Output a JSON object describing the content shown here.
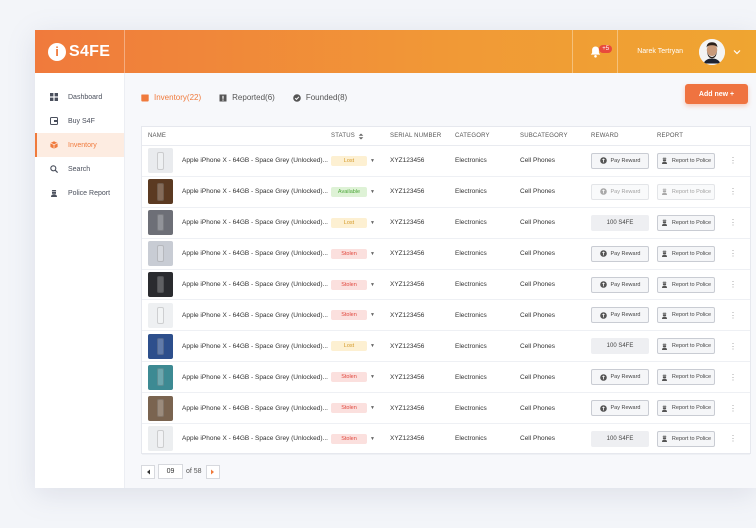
{
  "brand": {
    "logo_letter": "i",
    "name": "S4FE"
  },
  "header": {
    "notification_badge": "+5",
    "user_name": "Narek Tertryan",
    "icons": {
      "bell": "bell-icon",
      "chevron": "chevron-down-icon"
    }
  },
  "sidebar": {
    "items": [
      {
        "label": "Dashboard",
        "icon": "dashboard-icon",
        "active": false
      },
      {
        "label": "Buy S4F",
        "icon": "wallet-icon",
        "active": false
      },
      {
        "label": "Inventory",
        "icon": "box-icon",
        "active": true
      },
      {
        "label": "Search",
        "icon": "search-icon",
        "active": false
      },
      {
        "label": "Police Report",
        "icon": "police-icon",
        "active": false
      }
    ]
  },
  "tabs": [
    {
      "label": "Inventory(22)",
      "icon": "box-icon",
      "active": true
    },
    {
      "label": "Reported(6)",
      "icon": "report-icon",
      "active": false
    },
    {
      "label": "Founded(8)",
      "icon": "check-circle-icon",
      "active": false
    }
  ],
  "add_new": "Add new  +",
  "table": {
    "columns": [
      "NAME",
      "STATUS",
      "SERIAL NUMBER",
      "CATEGORY",
      "SUBCATEGORY",
      "REWARD",
      "REPORT"
    ],
    "status_sort_icon": "sort-icon",
    "rows": [
      {
        "name": "Apple iPhone X - 64GB - Space Grey (Unlocked)...",
        "status": "Lost",
        "status_type": "lost",
        "serial": "XYZ123456",
        "category": "Electronics",
        "subcategory": "Cell Phones",
        "reward": "Pay Reward",
        "reward_type": "button",
        "reward_disabled": false,
        "report": "Report to Police",
        "report_disabled": false,
        "thumb_color": "#e9ebee"
      },
      {
        "name": "Apple iPhone X - 64GB - Space Grey (Unlocked)...",
        "status": "Available",
        "status_type": "available",
        "serial": "XYZ123456",
        "category": "Electronics",
        "subcategory": "Cell Phones",
        "reward": "Pay Reward",
        "reward_type": "button",
        "reward_disabled": true,
        "report": "Report to Police",
        "report_disabled": true,
        "thumb_color": "#5b3a22"
      },
      {
        "name": "Apple iPhone X - 64GB - Space Grey (Unlocked)...",
        "status": "Lost",
        "status_type": "lost",
        "serial": "XYZ123456",
        "category": "Electronics",
        "subcategory": "Cell Phones",
        "reward": "100 S4FE",
        "reward_type": "amount",
        "reward_disabled": false,
        "report": "Report to Police",
        "report_disabled": false,
        "thumb_color": "#6d6f77"
      },
      {
        "name": "Apple iPhone X - 64GB - Space Grey (Unlocked)...",
        "status": "Stolen",
        "status_type": "stolen",
        "serial": "XYZ123456",
        "category": "Electronics",
        "subcategory": "Cell Phones",
        "reward": "Pay Reward",
        "reward_type": "button",
        "reward_disabled": false,
        "report": "Report to Police",
        "report_disabled": false,
        "thumb_color": "#c8ccd4"
      },
      {
        "name": "Apple iPhone X - 64GB - Space Grey (Unlocked)...",
        "status": "Stolen",
        "status_type": "stolen",
        "serial": "XYZ123456",
        "category": "Electronics",
        "subcategory": "Cell Phones",
        "reward": "Pay Reward",
        "reward_type": "button",
        "reward_disabled": false,
        "report": "Report to Police",
        "report_disabled": false,
        "thumb_color": "#2a2b2f"
      },
      {
        "name": "Apple iPhone X - 64GB - Space Grey (Unlocked)...",
        "status": "Stolen",
        "status_type": "stolen",
        "serial": "XYZ123456",
        "category": "Electronics",
        "subcategory": "Cell Phones",
        "reward": "Pay Reward",
        "reward_type": "button",
        "reward_disabled": false,
        "report": "Report to Police",
        "report_disabled": false,
        "thumb_color": "#eef0f2"
      },
      {
        "name": "Apple iPhone X - 64GB - Space Grey (Unlocked)...",
        "status": "Lost",
        "status_type": "lost",
        "serial": "XYZ123456",
        "category": "Electronics",
        "subcategory": "Cell Phones",
        "reward": "100 S4FE",
        "reward_type": "amount",
        "reward_disabled": false,
        "report": "Report to Police",
        "report_disabled": false,
        "thumb_color": "#2d4f8c"
      },
      {
        "name": "Apple iPhone X - 64GB - Space Grey (Unlocked)...",
        "status": "Stolen",
        "status_type": "stolen",
        "serial": "XYZ123456",
        "category": "Electronics",
        "subcategory": "Cell Phones",
        "reward": "Pay Reward",
        "reward_type": "button",
        "reward_disabled": false,
        "report": "Report to Police",
        "report_disabled": false,
        "thumb_color": "#3d8a93"
      },
      {
        "name": "Apple iPhone X - 64GB - Space Grey (Unlocked)...",
        "status": "Stolen",
        "status_type": "stolen",
        "serial": "XYZ123456",
        "category": "Electronics",
        "subcategory": "Cell Phones",
        "reward": "Pay Reward",
        "reward_type": "button",
        "reward_disabled": false,
        "report": "Report to Police",
        "report_disabled": false,
        "thumb_color": "#7a6450"
      },
      {
        "name": "Apple iPhone X - 64GB - Space Grey (Unlocked)...",
        "status": "Stolen",
        "status_type": "stolen",
        "serial": "XYZ123456",
        "category": "Electronics",
        "subcategory": "Cell Phones",
        "reward": "100 S4FE",
        "reward_type": "amount",
        "reward_disabled": false,
        "report": "Report to Police",
        "report_disabled": false,
        "thumb_color": "#eceef0"
      }
    ]
  },
  "pagination": {
    "current": "09",
    "of_label": "of 58"
  },
  "colors": {
    "accent": "#f07a3c",
    "lost": "#d49a2a",
    "available": "#4ea83b",
    "stolen": "#e0463c"
  }
}
